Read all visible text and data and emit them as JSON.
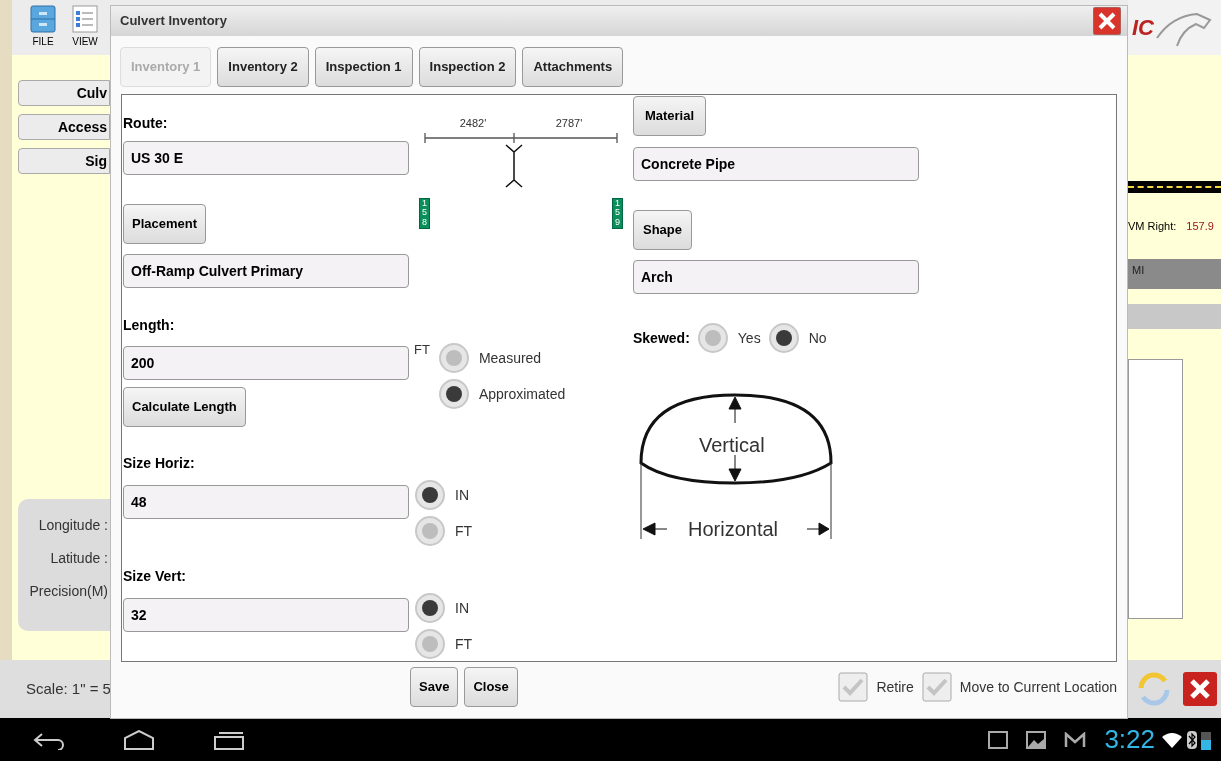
{
  "background_app": {
    "toolbar": [
      {
        "kind": "drawer",
        "label": "FILE"
      },
      {
        "kind": "list",
        "label": "VIEW"
      }
    ],
    "sidebar_buttons": [
      "Culv",
      "Access",
      "Sig"
    ],
    "location_labels": [
      "Longitude :",
      "Latitude :",
      "Precision(M)"
    ],
    "scale": "Scale: 1\" = 5",
    "logo_text": "IC",
    "marker": {
      "label": "VM Right:",
      "value": "157.9"
    },
    "unit": "MI"
  },
  "dialog": {
    "title": "Culvert Inventory",
    "tabs": [
      {
        "label": "Inventory 1",
        "selected": true
      },
      {
        "label": "Inventory 2",
        "selected": false
      },
      {
        "label": "Inspection 1",
        "selected": false
      },
      {
        "label": "Inspection 2",
        "selected": false
      },
      {
        "label": "Attachments",
        "selected": false
      }
    ],
    "route": {
      "label": "Route:",
      "value": "US 30 E"
    },
    "diagram": {
      "distances": [
        "2482'",
        "2787'"
      ],
      "mileposts": [
        "158",
        "159"
      ]
    },
    "placement": {
      "button": "Placement",
      "value": "Off-Ramp Culvert Primary"
    },
    "length": {
      "label": "Length:",
      "value": "200",
      "unit": "FT",
      "calculate_button": "Calculate Length",
      "options": [
        {
          "label": "Measured",
          "selected": false
        },
        {
          "label": "Approximated",
          "selected": true
        }
      ]
    },
    "size_horiz": {
      "label": "Size Horiz:",
      "value": "48",
      "options": [
        {
          "label": "IN",
          "selected": true
        },
        {
          "label": "FT",
          "selected": false
        }
      ]
    },
    "size_vert": {
      "label": "Size Vert:",
      "value": "32",
      "options": [
        {
          "label": "IN",
          "selected": true
        },
        {
          "label": "FT",
          "selected": false
        }
      ]
    },
    "material": {
      "button": "Material",
      "value": "Concrete Pipe"
    },
    "shape": {
      "button": "Shape",
      "value": "Arch"
    },
    "skewed": {
      "label": "Skewed:",
      "options": [
        {
          "label": "Yes",
          "selected": false
        },
        {
          "label": "No",
          "selected": true
        }
      ]
    },
    "shape_diagram": {
      "vertical": "Vertical",
      "horizontal": "Horizontal"
    },
    "buttons": [
      "Save",
      "Close"
    ],
    "checkboxes": [
      {
        "label": "Retire",
        "checked": false
      },
      {
        "label": "Move to Current Location",
        "checked": false
      }
    ]
  },
  "status_bar": {
    "time": "3:22"
  }
}
